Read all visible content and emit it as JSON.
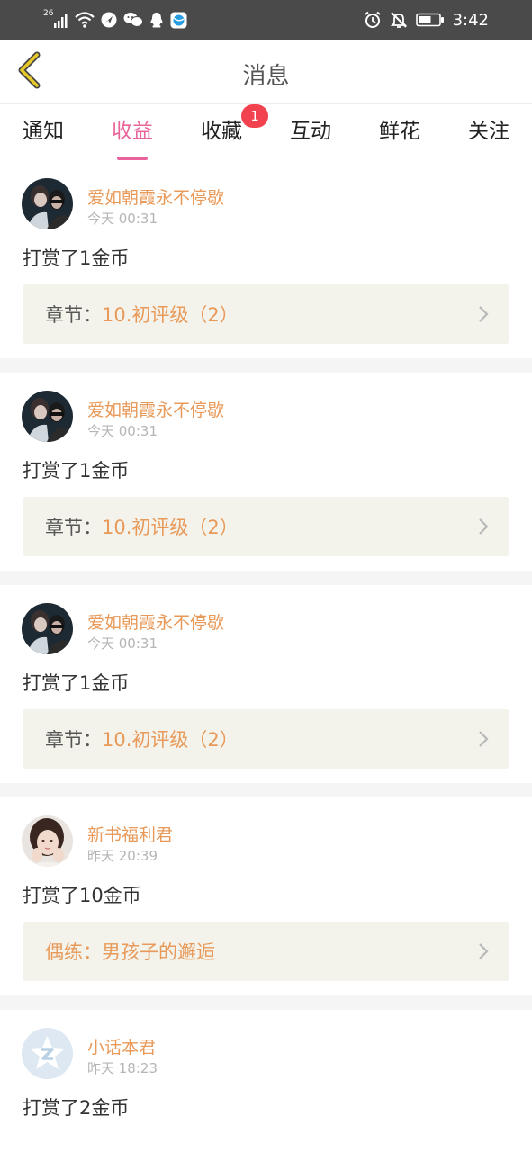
{
  "status_bar": {
    "network_label": "26",
    "time": "3:42",
    "left_icons": [
      "signal-icon",
      "wifi-icon",
      "app-arrow-icon",
      "wechat-icon",
      "qq-icon",
      "browser-icon"
    ],
    "right_icons": [
      "alarm-icon",
      "mute-icon",
      "battery-icon"
    ]
  },
  "header": {
    "title": "消息",
    "back_icon": "chevron-left-icon",
    "accent_color": "#e8c92a"
  },
  "tabs": {
    "items": [
      {
        "label": "通知",
        "active": false
      },
      {
        "label": "收益",
        "active": true
      },
      {
        "label": "收藏",
        "active": false,
        "badge": "1"
      },
      {
        "label": "互动",
        "active": false
      },
      {
        "label": "鲜花",
        "active": false
      },
      {
        "label": "关注",
        "active": false
      }
    ],
    "active_color": "#e8649a",
    "badge_color": "#f2414f"
  },
  "messages": [
    {
      "user": "爱如朝霞永不停歇",
      "time": "今天 00:31",
      "text": "打赏了1金币",
      "chapter_prefix": "章节：",
      "chapter_name": "10.初评级（2）",
      "avatar": "portrait-couple"
    },
    {
      "user": "爱如朝霞永不停歇",
      "time": "今天 00:31",
      "text": "打赏了1金币",
      "chapter_prefix": "章节：",
      "chapter_name": "10.初评级（2）",
      "avatar": "portrait-couple"
    },
    {
      "user": "爱如朝霞永不停歇",
      "time": "今天 00:31",
      "text": "打赏了1金币",
      "chapter_prefix": "章节：",
      "chapter_name": "10.初评级（2）",
      "avatar": "portrait-couple"
    },
    {
      "user": "新书福利君",
      "time": "昨天 20:39",
      "text": "打赏了10金币",
      "chapter_prefix": "",
      "chapter_name": "偶练：男孩子的邂逅",
      "avatar": "portrait-girl"
    },
    {
      "user": "小话本君",
      "time": "昨天 18:23",
      "text": "打赏了2金币",
      "chapter_prefix": "",
      "chapter_name": "",
      "avatar": "logo-star"
    }
  ],
  "colors": {
    "username": "#e89a5a",
    "chapter_bg": "#f3f3ec",
    "separator": "#f5f5f5"
  }
}
